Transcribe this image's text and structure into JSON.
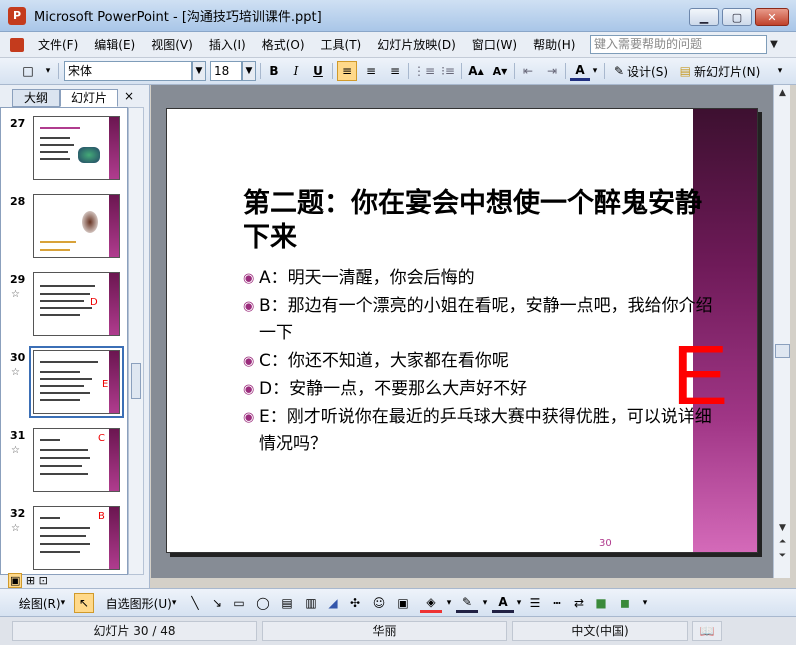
{
  "window": {
    "title": "Microsoft PowerPoint - [沟通技巧培训课件.ppt]",
    "controls": [
      "minimize",
      "restore",
      "close"
    ]
  },
  "menu": {
    "items": [
      "文件(F)",
      "编辑(E)",
      "视图(V)",
      "插入(I)",
      "格式(O)",
      "工具(T)",
      "幻灯片放映(D)",
      "窗口(W)",
      "帮助(H)"
    ],
    "help_placeholder": "键入需要帮助的问题"
  },
  "toolbar": {
    "font_name": "宋体",
    "font_size": "18",
    "bold": "B",
    "italic": "I",
    "underline": "U",
    "design_label": "设计(S)",
    "new_slide_label": "新幻灯片(N)"
  },
  "left_panel": {
    "tabs": [
      "大纲",
      "幻灯片"
    ],
    "active_tab": "幻灯片",
    "close_glyph": "×",
    "thumbnails": [
      {
        "number": "27",
        "starred": false,
        "selected": false
      },
      {
        "number": "28",
        "starred": false,
        "selected": false
      },
      {
        "number": "29",
        "starred": true,
        "selected": false,
        "letter": "D"
      },
      {
        "number": "30",
        "starred": true,
        "selected": true,
        "letter": "E"
      },
      {
        "number": "31",
        "starred": true,
        "selected": false,
        "letter": "C"
      },
      {
        "number": "32",
        "starred": true,
        "selected": false,
        "letter": "B"
      }
    ]
  },
  "slide": {
    "title": "第二题：你在宴会中想使一个醉鬼安静下来",
    "bullets": [
      "A：明天一清醒，你会后悔的",
      "B：那边有一个漂亮的小姐在看呢，安静一点吧，我给你介绍一下",
      "C：你还不知道，大家都在看你呢",
      "D：安静一点，不要那么大声好不好",
      "E：刚才听说你在最近的乒乓球大赛中获得优胜，可以说详细情况吗？"
    ],
    "answer_letter": "E",
    "page_number": "30",
    "accent_color": "#9b2c7c",
    "answer_color": "#ff0000"
  },
  "drawing_toolbar": {
    "draw_label": "绘图(R)",
    "autoshapes_label": "自选图形(U)"
  },
  "status": {
    "slide_info": "幻灯片 30 / 48",
    "design_name": "华丽",
    "language": "中文(中国)"
  }
}
